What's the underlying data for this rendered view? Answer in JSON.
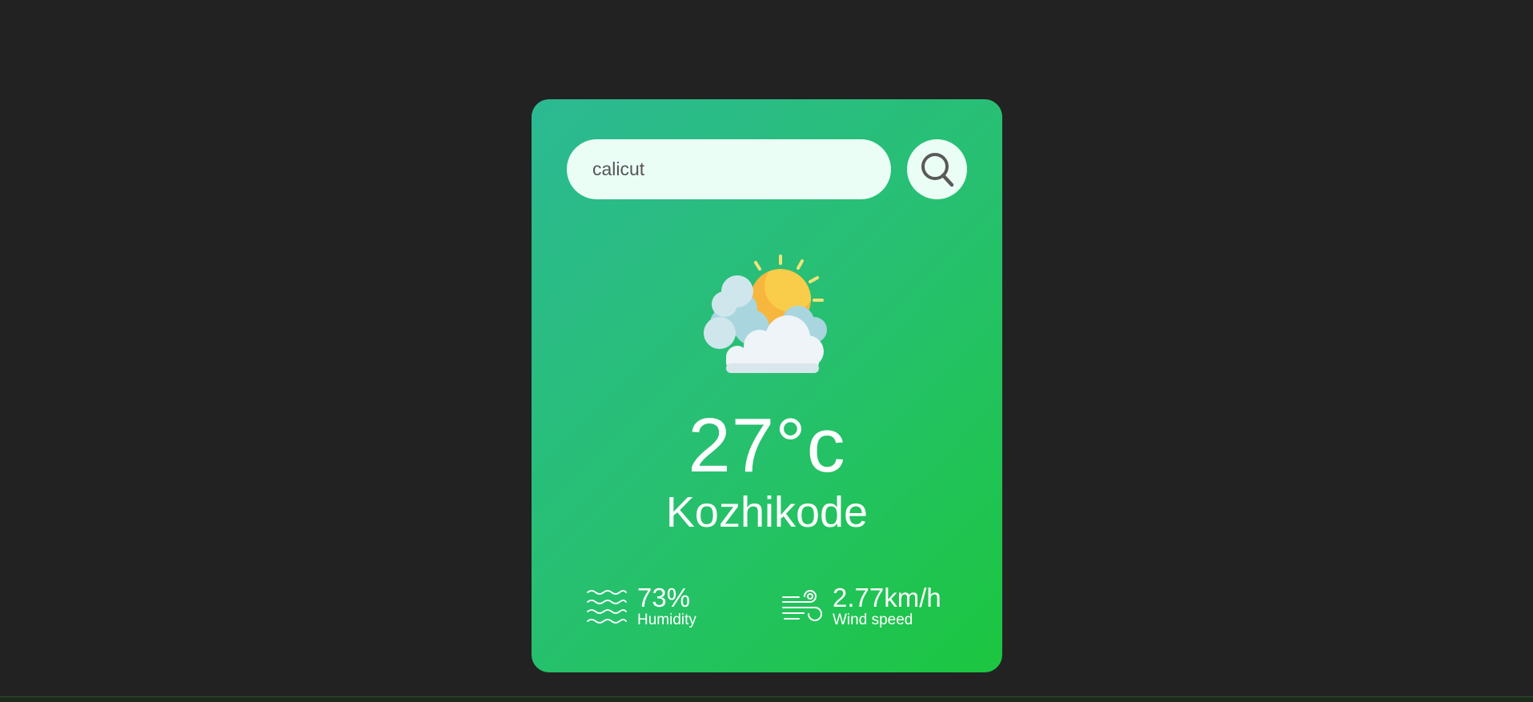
{
  "search": {
    "value": "calicut",
    "icon": "search-icon"
  },
  "weather": {
    "icon": "partly-cloudy-icon",
    "temperature": "27°c",
    "city": "Kozhikode"
  },
  "details": {
    "humidity": {
      "icon": "humidity-waves-icon",
      "value": "73%",
      "label": "Humidity"
    },
    "wind": {
      "icon": "wind-icon",
      "value": "2.77km/h",
      "label": "Wind speed"
    }
  },
  "colors": {
    "background": "#222222",
    "card_gradient_start": "#2cb993",
    "card_gradient_end": "#1bc63f",
    "input_background": "#ebfef6",
    "text": "#ffffff"
  }
}
